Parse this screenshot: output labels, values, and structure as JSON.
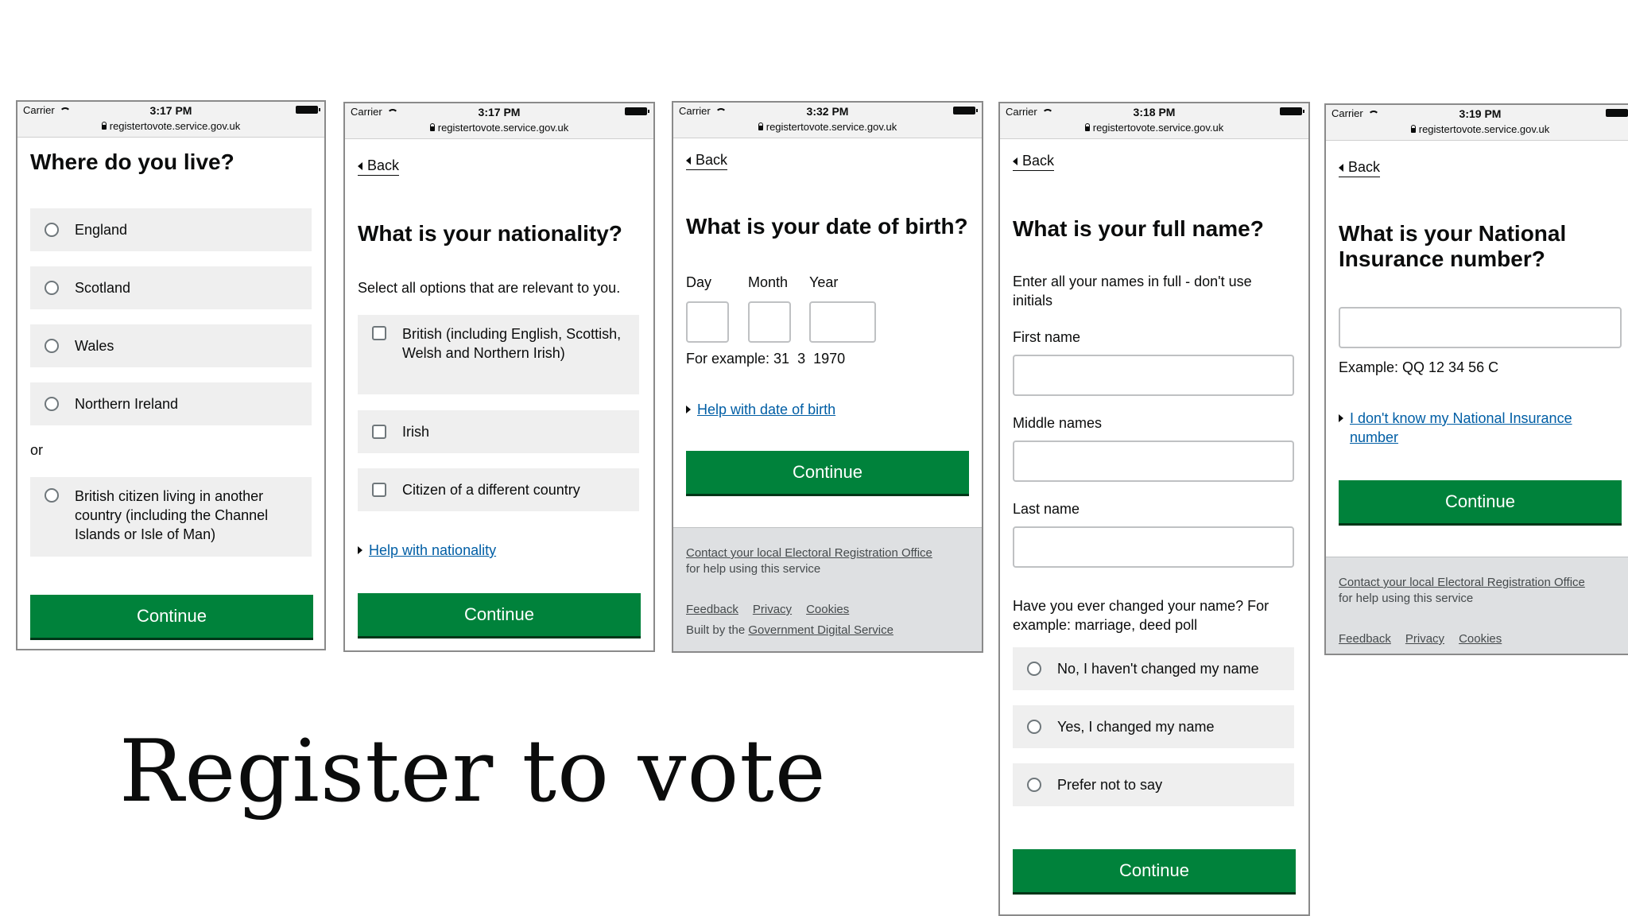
{
  "status_bar": {
    "carrier": "Carrier",
    "url": "registertovote.service.gov.uk",
    "times": [
      "3:17 PM",
      "3:17 PM",
      "3:32 PM",
      "3:18 PM",
      "3:19 PM"
    ]
  },
  "common": {
    "back": "Back",
    "continue": "Continue"
  },
  "screen1": {
    "title": "Where do you live?",
    "options": [
      "England",
      "Scotland",
      "Wales",
      "Northern Ireland"
    ],
    "or": "or",
    "other_option": "British citizen living in another country (including the Channel Islands or Isle of Man)"
  },
  "screen2": {
    "title": "What is your nationality?",
    "hint": "Select all options that are relevant to you.",
    "options": [
      "British (including English, Scottish, Welsh and Northern Irish)",
      "Irish",
      "Citizen of a different country"
    ],
    "help": "Help with nationality"
  },
  "screen3": {
    "title": "What is your date of birth?",
    "day": "Day",
    "month": "Month",
    "year": "Year",
    "example": "For example: 31  3  1970",
    "help": "Help with date of birth",
    "footer": {
      "contact_link": "Contact your local Electoral Registration Office",
      "contact_rest": " for help using this service",
      "links": [
        "Feedback",
        "Privacy",
        "Cookies"
      ],
      "built_by": "Built by the ",
      "built_link": "Government Digital Service"
    }
  },
  "screen4": {
    "title": "What is your full name?",
    "hint": "Enter all your names in full - don't use initials",
    "first": "First name",
    "middle": "Middle names",
    "last": "Last name",
    "changed_q": "Have you ever changed your name? For example: marriage, deed poll",
    "options": [
      "No, I haven't changed my name",
      "Yes, I changed my name",
      "Prefer not to say"
    ]
  },
  "screen5": {
    "title": "What is your National Insurance number?",
    "example": "Example: QQ 12 34 56 C",
    "help": "I don't know my National Insurance number",
    "footer": {
      "contact_link": "Contact your local Electoral Registration Office",
      "contact_rest": " for help using this service",
      "links": [
        "Feedback",
        "Privacy",
        "Cookies"
      ]
    }
  },
  "caption": "Register to vote"
}
